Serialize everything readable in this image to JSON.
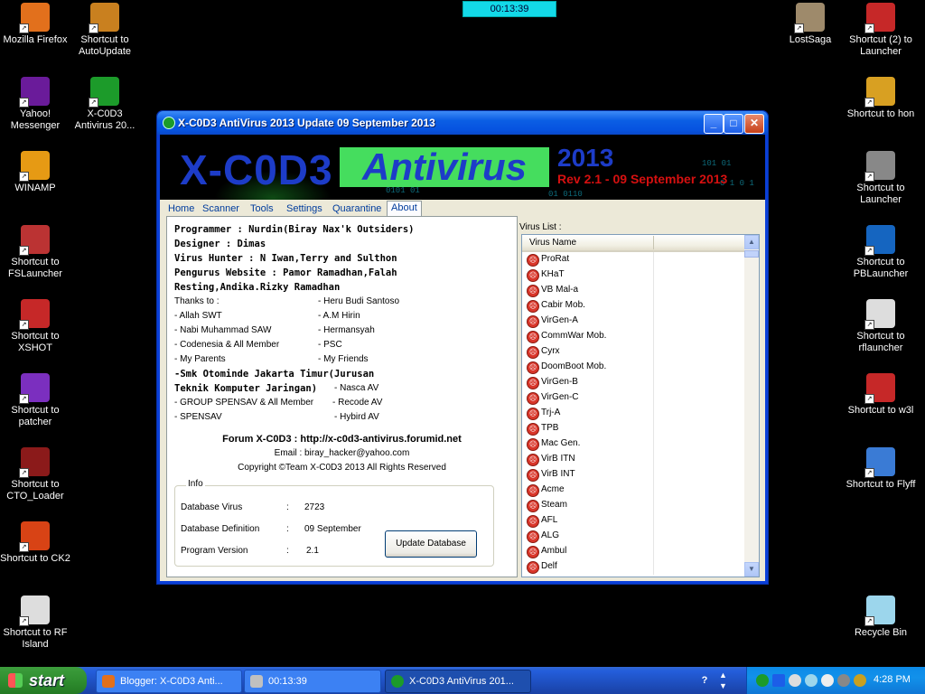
{
  "timer_top": "00:13:39",
  "desktop_left": [
    {
      "label": "Mozilla Firefox",
      "color": "#e2701c"
    },
    {
      "label": "Shortcut to AutoUpdate",
      "color": "#c9801f"
    },
    {
      "label": "Yahoo! Messenger",
      "color": "#6a1b9a"
    },
    {
      "label": "X-C0D3 Antivirus 20...",
      "color": "#1c9b2a"
    },
    {
      "label": "WINAMP",
      "color": "#e69a14"
    },
    {
      "label": "Shortcut to FSLauncher",
      "color": "#b33"
    },
    {
      "label": "Shortcut to XSHOT",
      "color": "#c62828"
    },
    {
      "label": "Shortcut to patcher",
      "color": "#7b2fbf"
    },
    {
      "label": "Shortcut to CTO_Loader",
      "color": "#8b1a1a"
    },
    {
      "label": "Shortcut to CK2",
      "color": "#d84315"
    },
    {
      "label": "Shortcut to RF Island",
      "color": "#ddd"
    }
  ],
  "desktop_right": [
    {
      "label": "LostSaga",
      "color": "#9e8a6b"
    },
    {
      "label": "Shortcut (2) to Launcher",
      "color": "#c62828"
    },
    {
      "label": "Shortcut to hon",
      "color": "#d8a022"
    },
    {
      "label": "Shortcut to Launcher",
      "color": "#888"
    },
    {
      "label": "Shortcut to PBLauncher",
      "color": "#1565c0"
    },
    {
      "label": "Shortcut to rflauncher",
      "color": "#ddd"
    },
    {
      "label": "Shortcut to w3l",
      "color": "#c62828"
    },
    {
      "label": "Shortcut to Flyff",
      "color": "#3a7bd5"
    },
    {
      "label": "Recycle Bin",
      "color": "#9cd6ec"
    }
  ],
  "window": {
    "title": "X-C0D3 AntiVirus 2013 Update 09 September 2013",
    "btn_min": "_",
    "btn_max": "□",
    "btn_close": "✕",
    "banner": {
      "logo": "X-C0D3",
      "antivirus": "Antivirus",
      "year": "2013",
      "rev": "Rev 2.1 - 09 September 2013",
      "binary_1": "0101 01",
      "binary_2": "01 0110",
      "binary_3": "101 01",
      "binary_4": "0 1 0 1"
    },
    "tabs": [
      "Home",
      "Scanner",
      "Tools",
      "Settings",
      "Quarantine",
      "About"
    ],
    "active_tab": "About",
    "about": {
      "programmer": "Programmer : Nurdin(Biray Nax'k Outsiders)",
      "designer": "Designer : Dimas",
      "hunter": "Virus Hunter : N Iwan,Terry and Sulthon",
      "pengurus_1": "Pengurus Website : Pamor Ramadhan,Falah",
      "pengurus_2": "Resting,Andika.Rizky Ramadhan",
      "thanks": "Thanks to :",
      "thanks_left": [
        "- Allah SWT",
        "- Nabi Muhammad SAW",
        "- Codenesia & All Member",
        "- My Parents"
      ],
      "thanks_right": [
        "- Heru Budi Santoso",
        "- A.M Hirin",
        "- Hermansyah",
        "- PSC",
        "- My Friends"
      ],
      "smk_1": "-Smk Otominde Jakarta Timur(Jurusan",
      "smk_2": "Teknik Komputer Jaringan)",
      "nasca": "- Nasca AV",
      "group": "- GROUP SPENSAV &  All Member",
      "recode": "- Recode AV",
      "spensav": "- SPENSAV",
      "hybird": "- Hybird AV",
      "forum": "Forum X-C0D3 : http://x-c0d3-antivirus.forumid.net",
      "email": "Email : biray_hacker@yahoo.com",
      "copyright": "Copyright ©Team X-C0D3 2013 All Rights Reserved"
    },
    "info": {
      "legend": "Info",
      "rows": [
        {
          "label": "Database Virus",
          "sep": ":",
          "value": "2723"
        },
        {
          "label": "Database Definition",
          "sep": ":",
          "value": "09 September"
        },
        {
          "label": "Program Version",
          "sep": ":",
          "value": "2.1"
        }
      ],
      "update_button": "Update Database"
    },
    "virus_list": {
      "label": "Virus List :",
      "column": "Virus Name",
      "items": [
        "ProRat",
        "KHaT",
        "VB Mal-a",
        "Cabir Mob.",
        "VirGen-A",
        "CommWar Mob.",
        "Cyrx",
        "DoomBoot Mob.",
        "VirGen-B",
        "VirGen-C",
        "Trj-A",
        "TPB",
        "Mac Gen.",
        "VirB ITN",
        "VirB INT",
        "Acme",
        "Steam",
        "AFL",
        "ALG",
        "Ambul",
        "Delf"
      ]
    }
  },
  "taskbar": {
    "start": "start",
    "tasks": [
      {
        "label": "Blogger: X-C0D3 Anti...",
        "color": "#e2701c"
      },
      {
        "label": "00:13:39",
        "color": "#c0c0c0"
      },
      {
        "label": "X-C0D3 AntiVirus 201...",
        "color": "#1c9b2a"
      }
    ],
    "clock": "4:28 PM"
  }
}
